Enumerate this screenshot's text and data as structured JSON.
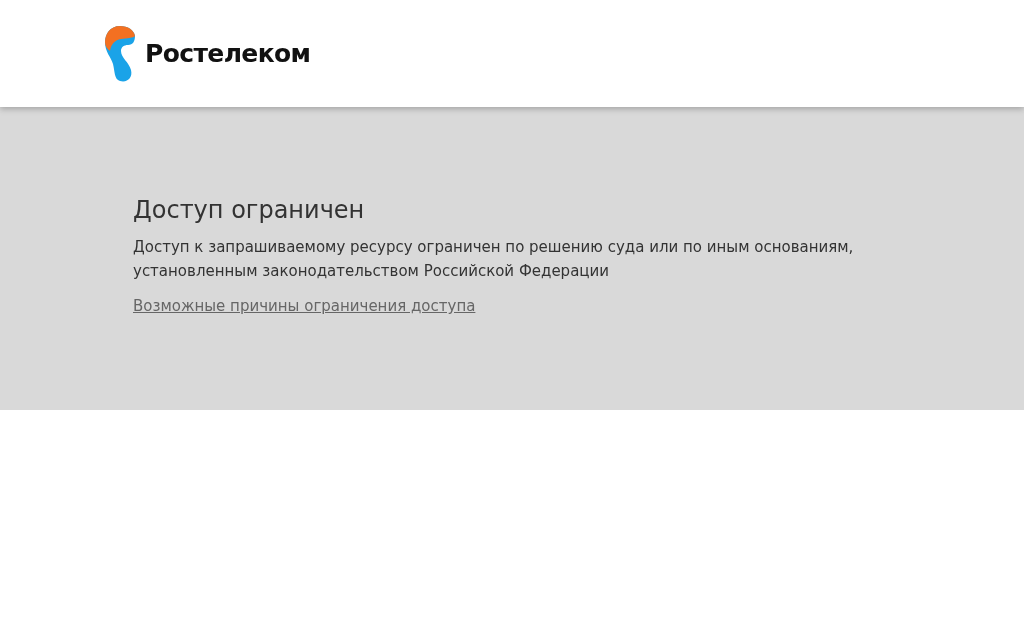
{
  "header": {
    "logo_text": "Ростелеком"
  },
  "notice": {
    "title": "Доступ ограничен",
    "message": "Доступ к запрашиваемому ресурсу ограничен по решению суда или по иным основаниям, установленным законодательством Российской Федерации",
    "link": "Возможные причины ограничения доступа"
  }
}
